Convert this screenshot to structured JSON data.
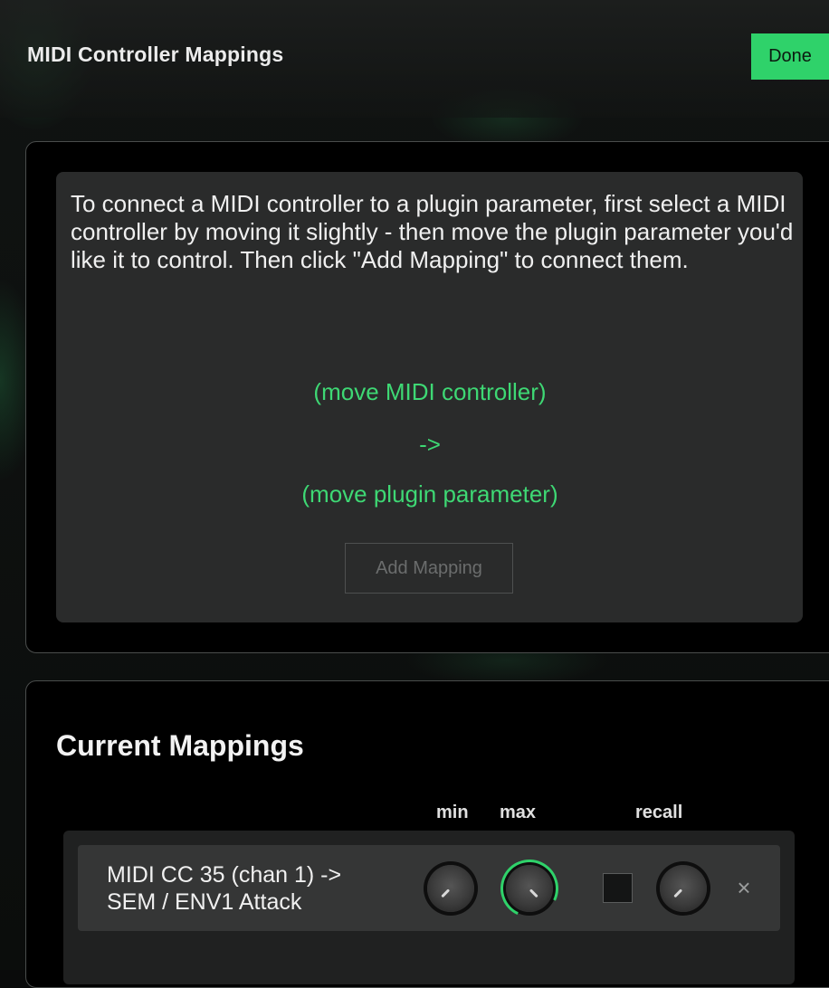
{
  "header": {
    "title": "MIDI Controller Mappings",
    "done_label": "Done"
  },
  "learn_panel": {
    "instructions": "To connect a MIDI controller to a plugin parameter, first select a MIDI controller by moving it slightly - then move the plugin parameter you'd like it to control. Then click \"Add Mapping\" to connect them.",
    "controller_prompt": "(move MIDI controller)",
    "arrow": "->",
    "parameter_prompt": "(move plugin parameter)",
    "add_mapping_label": "Add Mapping",
    "add_mapping_enabled": false
  },
  "mappings_panel": {
    "title": "Current Mappings",
    "columns": {
      "min": "min",
      "max": "max",
      "recall": "recall"
    },
    "rows": [
      {
        "source_line": "MIDI CC 35 (chan 1) ->",
        "target_line": "SEM / ENV1 Attack",
        "recall_checked": false,
        "remove_label": "×"
      }
    ]
  },
  "colors": {
    "accent": "#2fd26a",
    "prompt_text": "#3ed874",
    "panel_bg": "#000000",
    "card_bg": "#2a2b2b"
  },
  "icons": {
    "remove": "close-icon",
    "knobs": "rotary-knob"
  }
}
